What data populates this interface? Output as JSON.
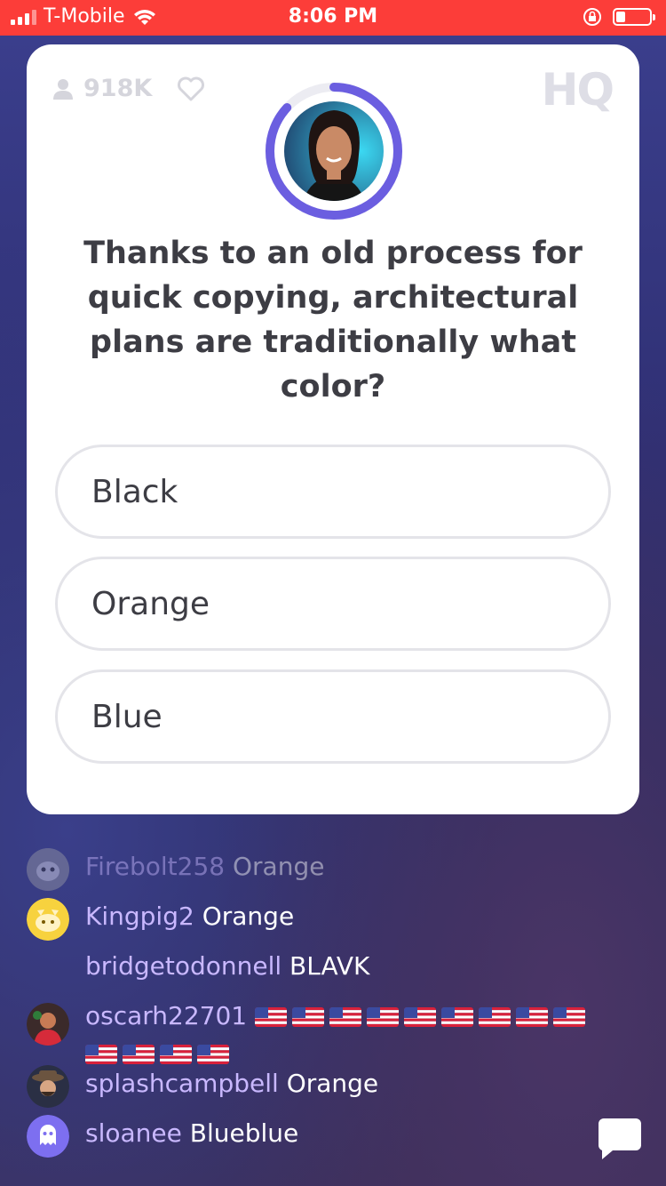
{
  "status_bar": {
    "carrier": "T-Mobile",
    "time": "8:06 PM"
  },
  "game": {
    "viewer_count": "918K",
    "logo": "HQ",
    "question": "Thanks to an old process for quick copying, architectural plans are traditionally what color?",
    "answers": [
      "Black",
      "Orange",
      "Blue"
    ],
    "timer_progress": 0.87,
    "accent_color": "#6b5ee0"
  },
  "chat": {
    "messages": [
      {
        "user": "Firebolt258",
        "text": "Orange"
      },
      {
        "user": "Kingpig2",
        "text": "Orange"
      },
      {
        "user": "bridgetodonnell",
        "text": "BLAVK"
      },
      {
        "user": "oscarh22701",
        "text": "",
        "flag_count": 13
      },
      {
        "user": "splashcampbell",
        "text": "Orange"
      },
      {
        "user": "sloanee",
        "text": "Blueblue"
      }
    ]
  },
  "icons": [
    "signal-icon",
    "wifi-icon",
    "rotation-lock-icon",
    "battery-icon",
    "viewer-icon",
    "heart-icon",
    "chat-bubble-icon"
  ]
}
